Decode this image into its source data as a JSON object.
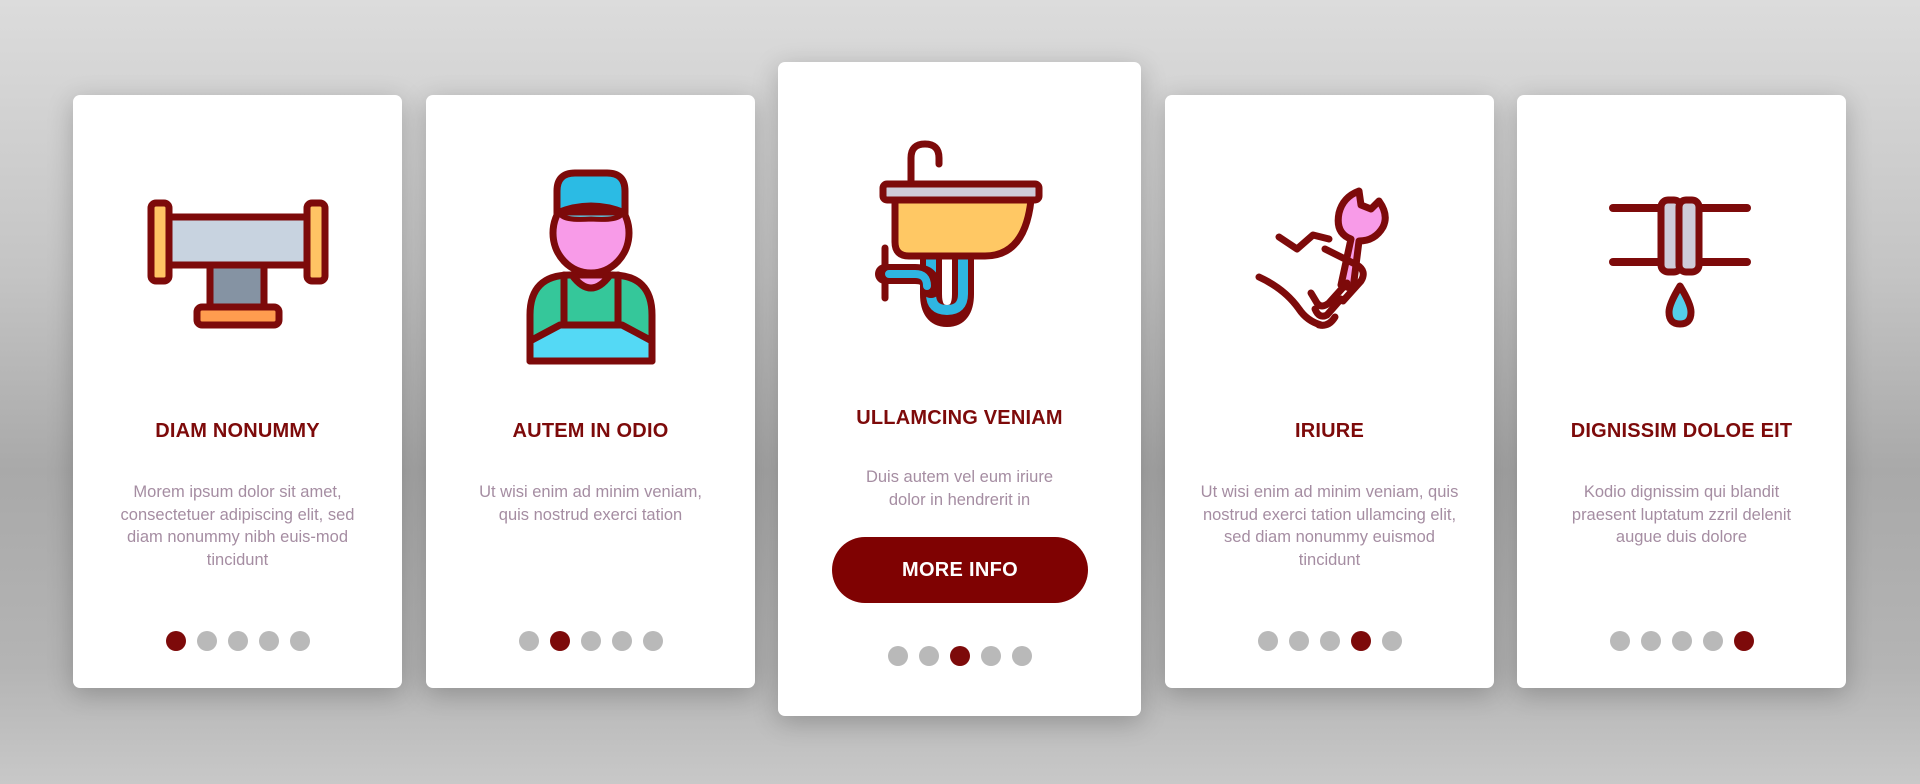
{
  "colors": {
    "accent": "#7d0a0a",
    "button": "#7f0202",
    "body_text": "#a58da2",
    "dot_inactive": "#b9b9b9",
    "dot_active": "#7d0a0a",
    "card_bg": "#ffffff"
  },
  "cards": [
    {
      "icon": "pipe-tee-icon",
      "title": "DIAM NONUMMY",
      "description": "Morem ipsum dolor sit amet, consectetuer adipiscing elit, sed diam nonummy nibh euis-mod tincidunt",
      "active_dot": 1,
      "dot_count": 5
    },
    {
      "icon": "plumber-worker-icon",
      "title": "AUTEM IN ODIO",
      "description": "Ut wisi enim ad minim veniam, quis nostrud exerci tation",
      "active_dot": 2,
      "dot_count": 5
    },
    {
      "icon": "sink-icon",
      "title": "ULLAMCING VENIAM",
      "description": "Duis autem vel eum iriure dolor in hendrerit in",
      "button_label": "MORE INFO",
      "active_dot": 3,
      "dot_count": 5
    },
    {
      "icon": "hand-wrench-icon",
      "title": "IRIURE",
      "description": "Ut wisi enim ad minim veniam, quis nostrud exerci tation ullamcing elit, sed diam nonummy euismod tincidunt",
      "active_dot": 4,
      "dot_count": 5
    },
    {
      "icon": "leaking-pipe-icon",
      "title": "DIGNISSIM DOLOE EIT",
      "description": "Kodio dignissim qui blandit praesent luptatum zzril delenit augue duis dolore",
      "active_dot": 5,
      "dot_count": 5
    }
  ]
}
